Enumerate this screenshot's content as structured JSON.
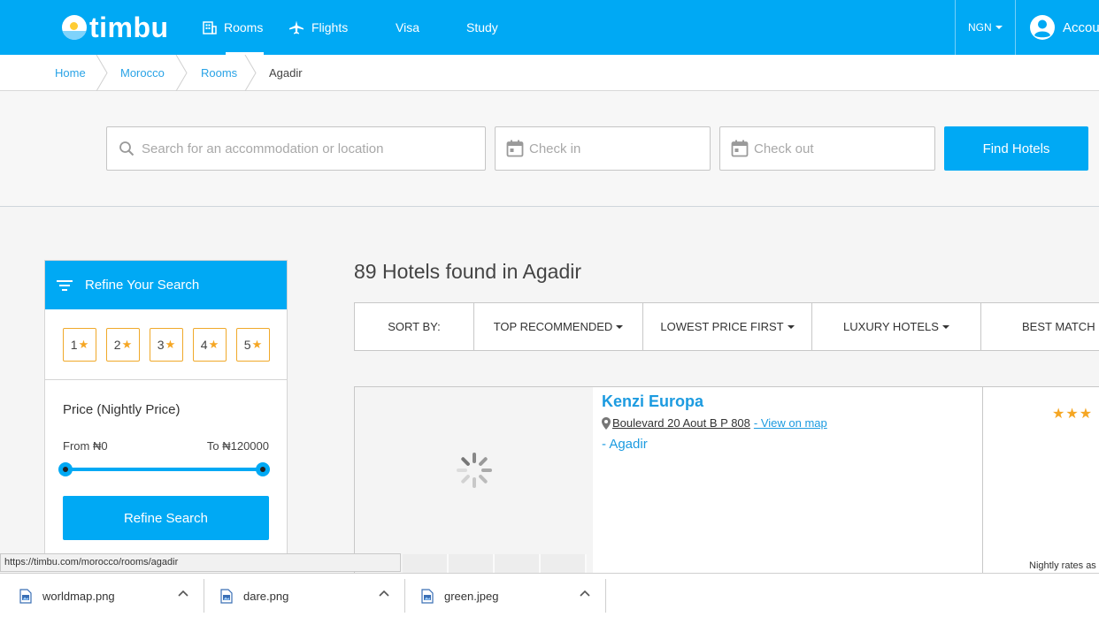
{
  "brand": {
    "name": "timbu"
  },
  "nav": {
    "rooms": "Rooms",
    "flights": "Flights",
    "visa": "Visa",
    "study": "Study",
    "currency": "NGN",
    "account": "Account"
  },
  "breadcrumb": [
    {
      "label": "Home"
    },
    {
      "label": "Morocco"
    },
    {
      "label": "Rooms"
    },
    {
      "label": "Agadir"
    }
  ],
  "search": {
    "location_placeholder": "Search for an accommodation or location",
    "checkin_placeholder": "Check in",
    "checkout_placeholder": "Check out",
    "button": "Find Hotels"
  },
  "sidebar": {
    "title": "Refine Your Search",
    "stars": [
      "1",
      "2",
      "3",
      "4",
      "5"
    ],
    "price_title": "Price (Nightly Price)",
    "from": "From ₦0",
    "to": "To ₦120000",
    "button": "Refine Search"
  },
  "results": {
    "title": "89 Hotels found in Agadir",
    "sort_label": "SORT BY:",
    "sort_options": [
      "TOP RECOMMENDED",
      "LOWEST PRICE FIRST",
      "LUXURY HOTELS",
      "BEST MATCH"
    ]
  },
  "hotel": {
    "name": "Kenzi Europa",
    "address": "Boulevard 20 Aout B P 808",
    "map_link": "- View on map",
    "city": "- Agadir",
    "rating_stars": 3,
    "nightly": "Nightly rates as"
  },
  "status_url": "https://timbu.com/morocco/rooms/agadir",
  "downloads": [
    {
      "name": "worldmap.png"
    },
    {
      "name": "dare.png"
    },
    {
      "name": "green.jpeg"
    }
  ],
  "colors": {
    "brand_blue": "#00a9f4",
    "link_blue": "#1c9be0",
    "star_orange": "#f5a623"
  }
}
